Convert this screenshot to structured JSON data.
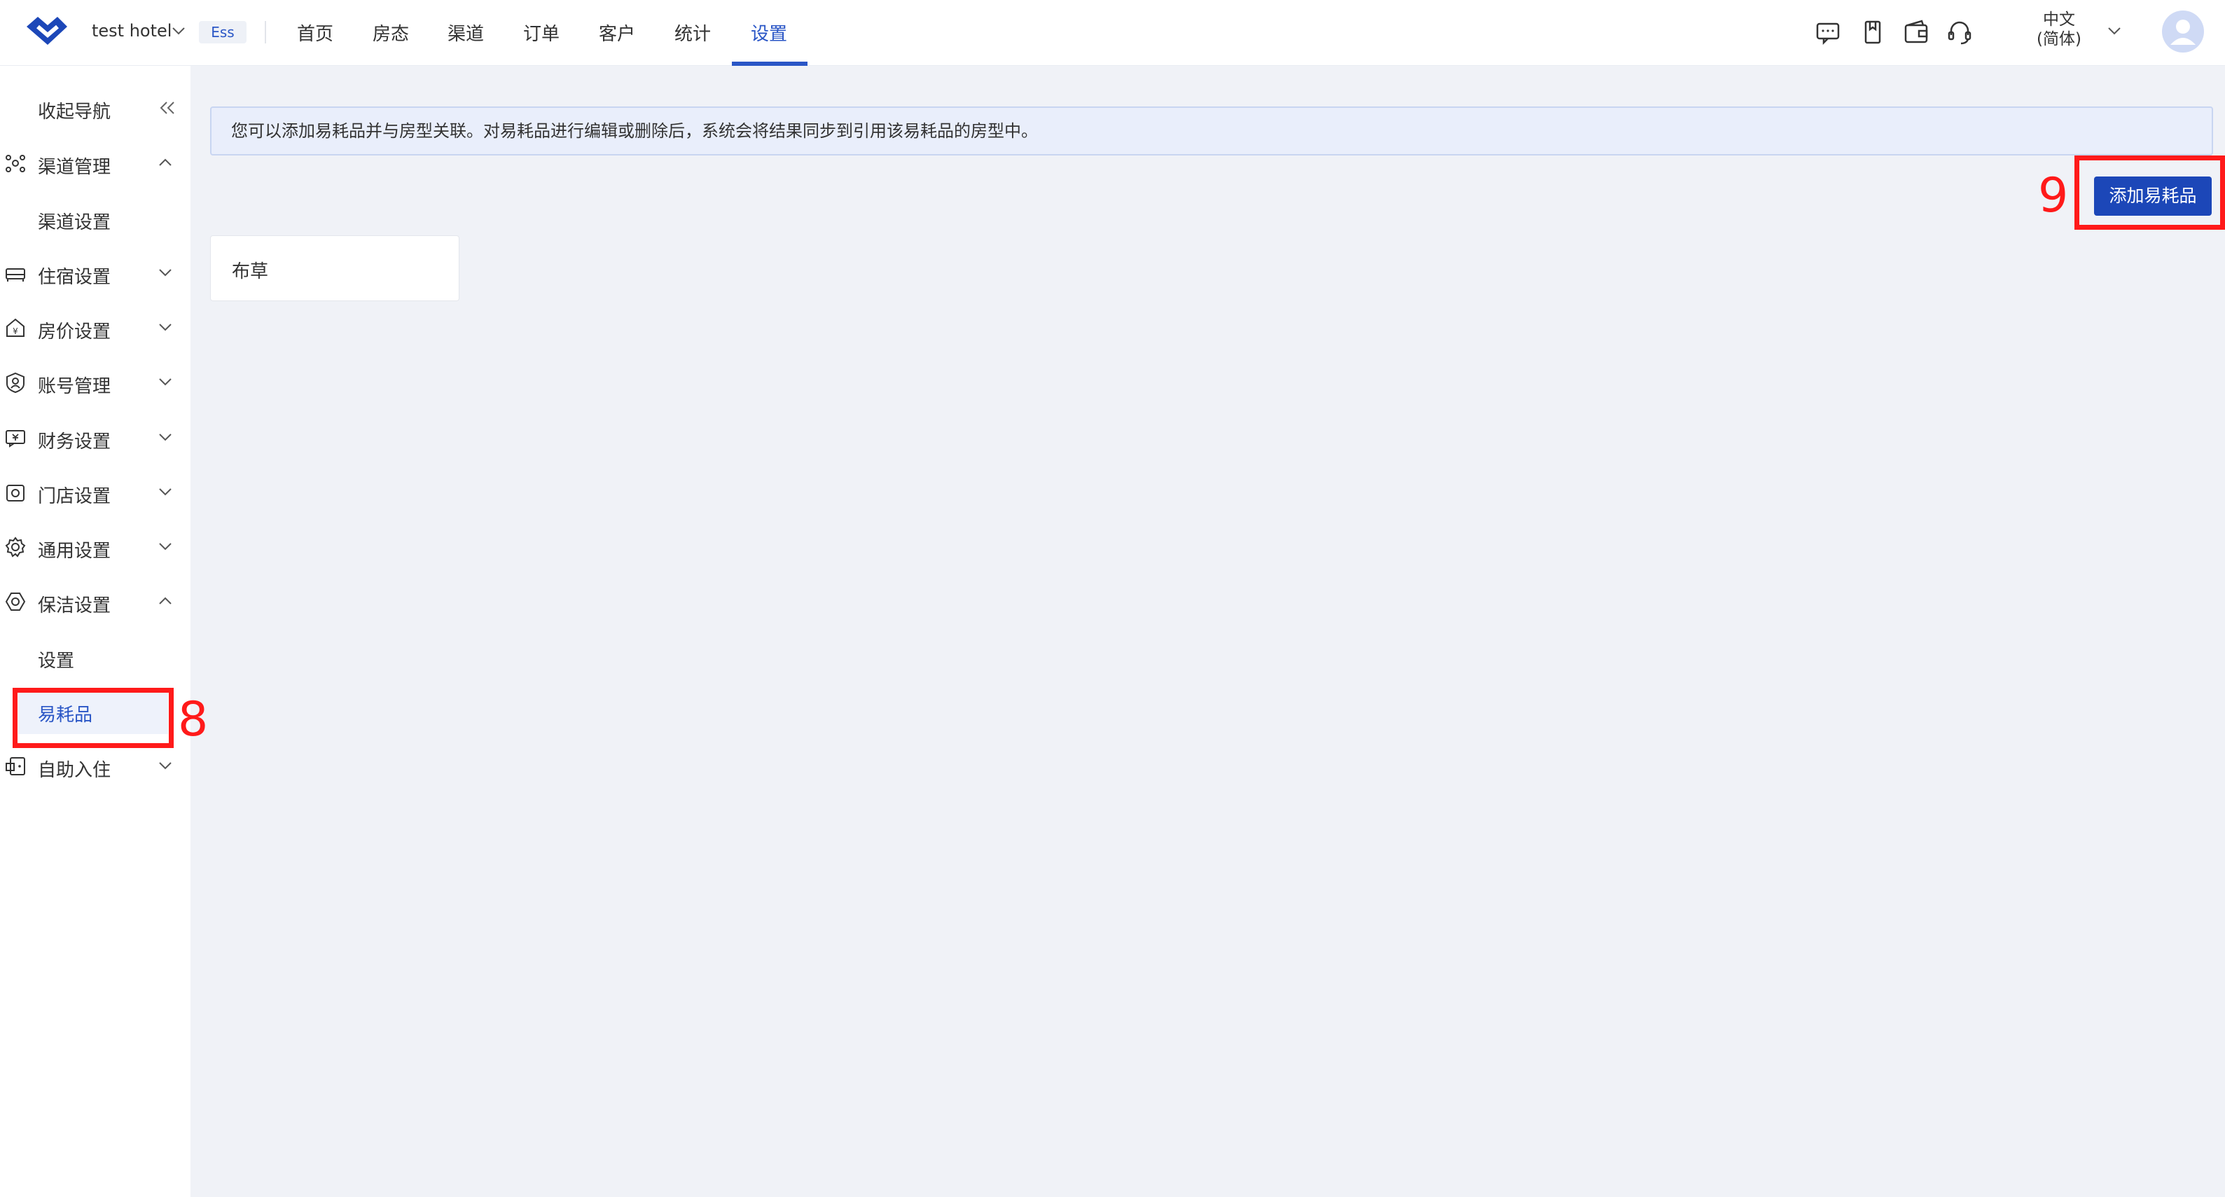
{
  "header": {
    "hotel_name": "test hotel",
    "ess_badge": "Ess",
    "tabs": [
      {
        "label": "首页"
      },
      {
        "label": "房态"
      },
      {
        "label": "渠道"
      },
      {
        "label": "订单"
      },
      {
        "label": "客户"
      },
      {
        "label": "统计"
      },
      {
        "label": "设置",
        "active": true
      }
    ],
    "language_line1": "中文",
    "language_line2": "(简体)",
    "icons": [
      "message-icon",
      "bookmark-icon",
      "wallet-icon",
      "headset-icon",
      "user-avatar"
    ]
  },
  "sidebar": {
    "collapse_label": "收起导航",
    "items": [
      {
        "label": "渠道管理",
        "icon": "channel-icon",
        "expanded": true
      },
      {
        "label": "渠道设置",
        "sub": true
      },
      {
        "label": "住宿设置",
        "icon": "bed-icon"
      },
      {
        "label": "房价设置",
        "icon": "price-icon"
      },
      {
        "label": "账号管理",
        "icon": "account-icon"
      },
      {
        "label": "财务设置",
        "icon": "finance-icon"
      },
      {
        "label": "门店设置",
        "icon": "store-icon"
      },
      {
        "label": "通用设置",
        "icon": "gear-icon"
      },
      {
        "label": "保洁设置",
        "icon": "cleaning-icon",
        "expanded": true
      },
      {
        "label": "设置",
        "sub": true
      },
      {
        "label": "易耗品",
        "sub": true,
        "selected": true
      },
      {
        "label": "自助入住",
        "icon": "self-checkin-icon"
      }
    ]
  },
  "main": {
    "notice": "您可以添加易耗品并与房型关联。对易耗品进行编辑或删除后，系统会将结果同步到引用该易耗品的房型中。",
    "add_button": "添加易耗品",
    "cards": [
      {
        "label": "布草"
      }
    ]
  },
  "annotations": [
    {
      "number": "8",
      "color": "#ff1a1a"
    },
    {
      "number": "9",
      "color": "#ff1a1a"
    }
  ],
  "colors": {
    "accent": "#2a56c6",
    "button": "#1c47b8",
    "annotation": "#ff1a1a",
    "main_bg": "#f0f2f7"
  }
}
